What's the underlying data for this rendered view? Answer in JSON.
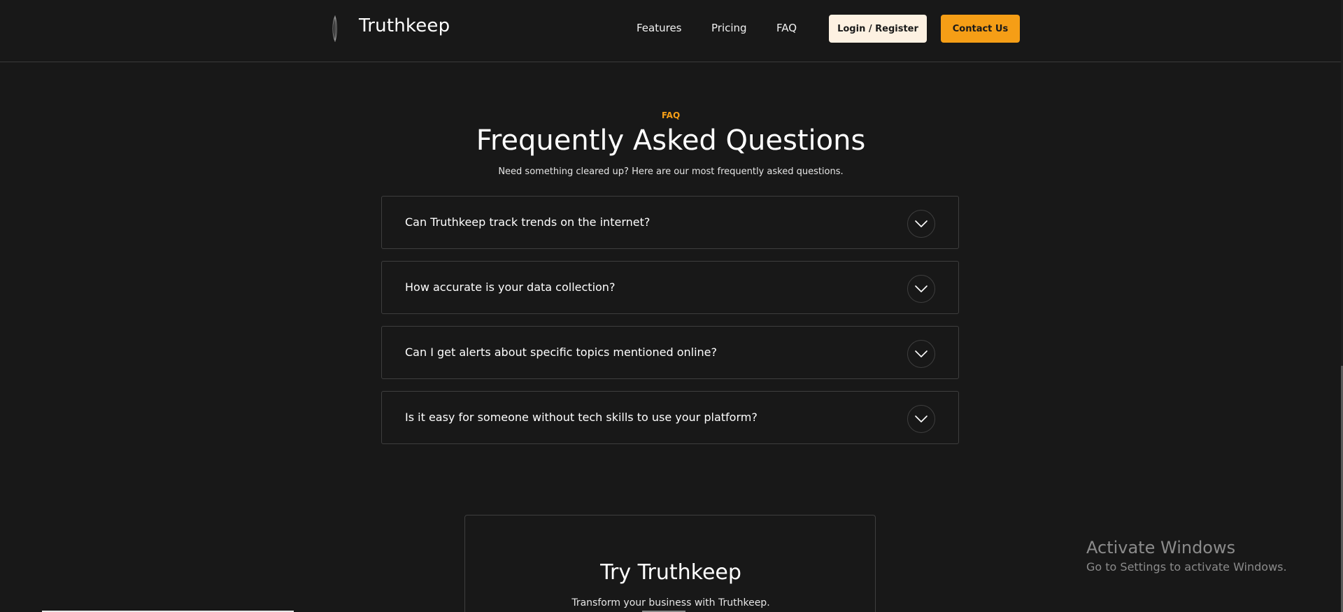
{
  "brand": {
    "name": "Truthkeep"
  },
  "nav": {
    "links": [
      "Features",
      "Pricing",
      "FAQ"
    ],
    "login_label": "Login / Register",
    "contact_label": "Contact Us"
  },
  "faq": {
    "eyebrow": "FAQ",
    "title": "Frequently Asked Questions",
    "subtitle": "Need something cleared up? Here are our most frequently asked questions.",
    "items": [
      {
        "question": "Can Truthkeep track trends on the internet?"
      },
      {
        "question": "How accurate is your data collection?"
      },
      {
        "question": "Can I get alerts about specific topics mentioned online?"
      },
      {
        "question": "Is it easy for someone without tech skills to use your platform?"
      }
    ]
  },
  "cta": {
    "title": "Try Truthkeep",
    "subtitle": "Transform your business with Truthkeep."
  },
  "watermark": {
    "title": "Activate Windows",
    "subtitle": "Go to Settings to activate Windows."
  },
  "colors": {
    "background": "#181818",
    "accent": "#f59e16",
    "login_button": "#fdf1e2",
    "border": "#3e3e3e"
  },
  "icons": {
    "logo": "feather-logo-icon",
    "faq_toggle": "chevron-down-icon"
  }
}
